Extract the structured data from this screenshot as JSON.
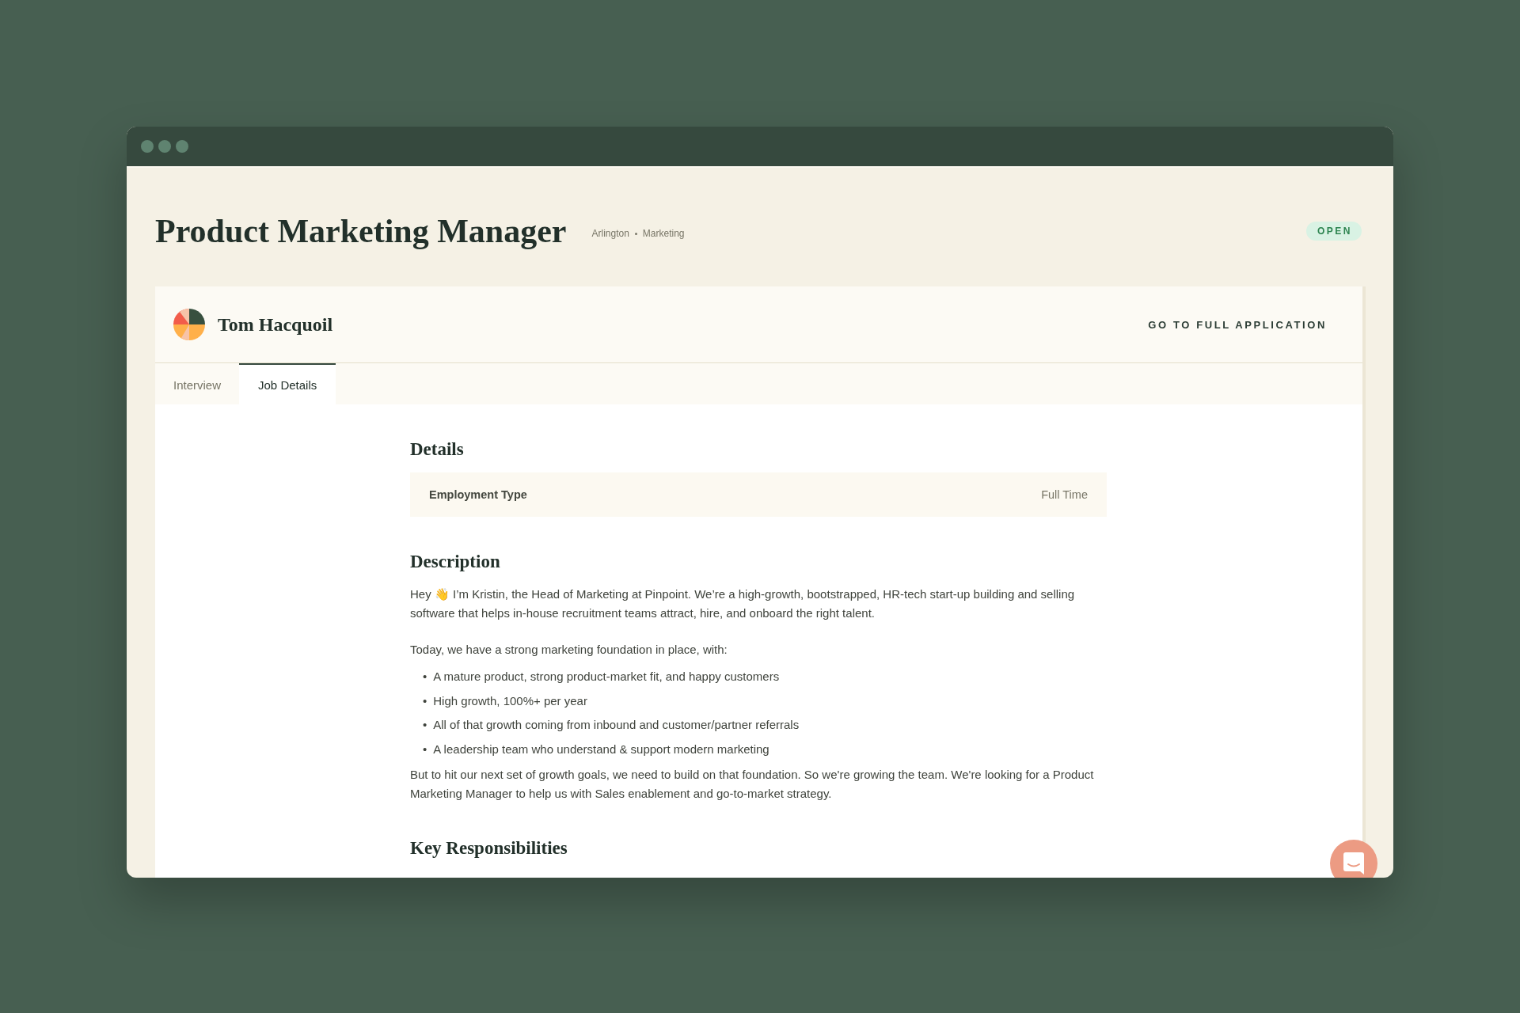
{
  "header": {
    "title": "Product Marketing Manager",
    "meta": [
      "Arlington",
      "Marketing"
    ],
    "status": "OPEN"
  },
  "candidate": {
    "name": "Tom Hacquoil",
    "action": "GO TO FULL APPLICATION"
  },
  "tabs": [
    {
      "label": "Interview",
      "selected": false
    },
    {
      "label": "Job Details",
      "selected": true
    }
  ],
  "sections": [
    {
      "heading": "Details",
      "blocks": [
        {
          "kind": "table",
          "rows": [
            {
              "label": "Employment Type",
              "value": "Full Time"
            }
          ]
        }
      ]
    },
    {
      "heading": "Description",
      "blocks": [
        {
          "kind": "paragraph",
          "text": "Hey 👋 I’m Kristin, the Head of Marketing at Pinpoint. We’re a high-growth, bootstrapped, HR-tech start-up building and selling software that helps in-house recruitment teams attract, hire, and onboard the right talent."
        },
        {
          "kind": "paragraph",
          "text": "Today, we have a strong marketing foundation in place, with:"
        },
        {
          "kind": "list",
          "items": [
            {
              "marker": "•",
              "text": "A mature product, strong product-market fit, and happy customers"
            },
            {
              "marker": "•",
              "text": "High growth, 100%+ per year"
            },
            {
              "marker": "•",
              "text": "All of that growth coming from inbound and customer/partner referrals"
            },
            {
              "marker": "•",
              "text": "A leadership team who understand & support modern marketing"
            }
          ]
        },
        {
          "kind": "paragraph",
          "text": "But to hit our next set of growth goals, we need to build on that foundation. So we're growing the team. We're looking for a Product Marketing Manager to help us with Sales enablement and go-to-market strategy."
        }
      ]
    },
    {
      "heading": "Key Responsibilities"
    }
  ]
}
